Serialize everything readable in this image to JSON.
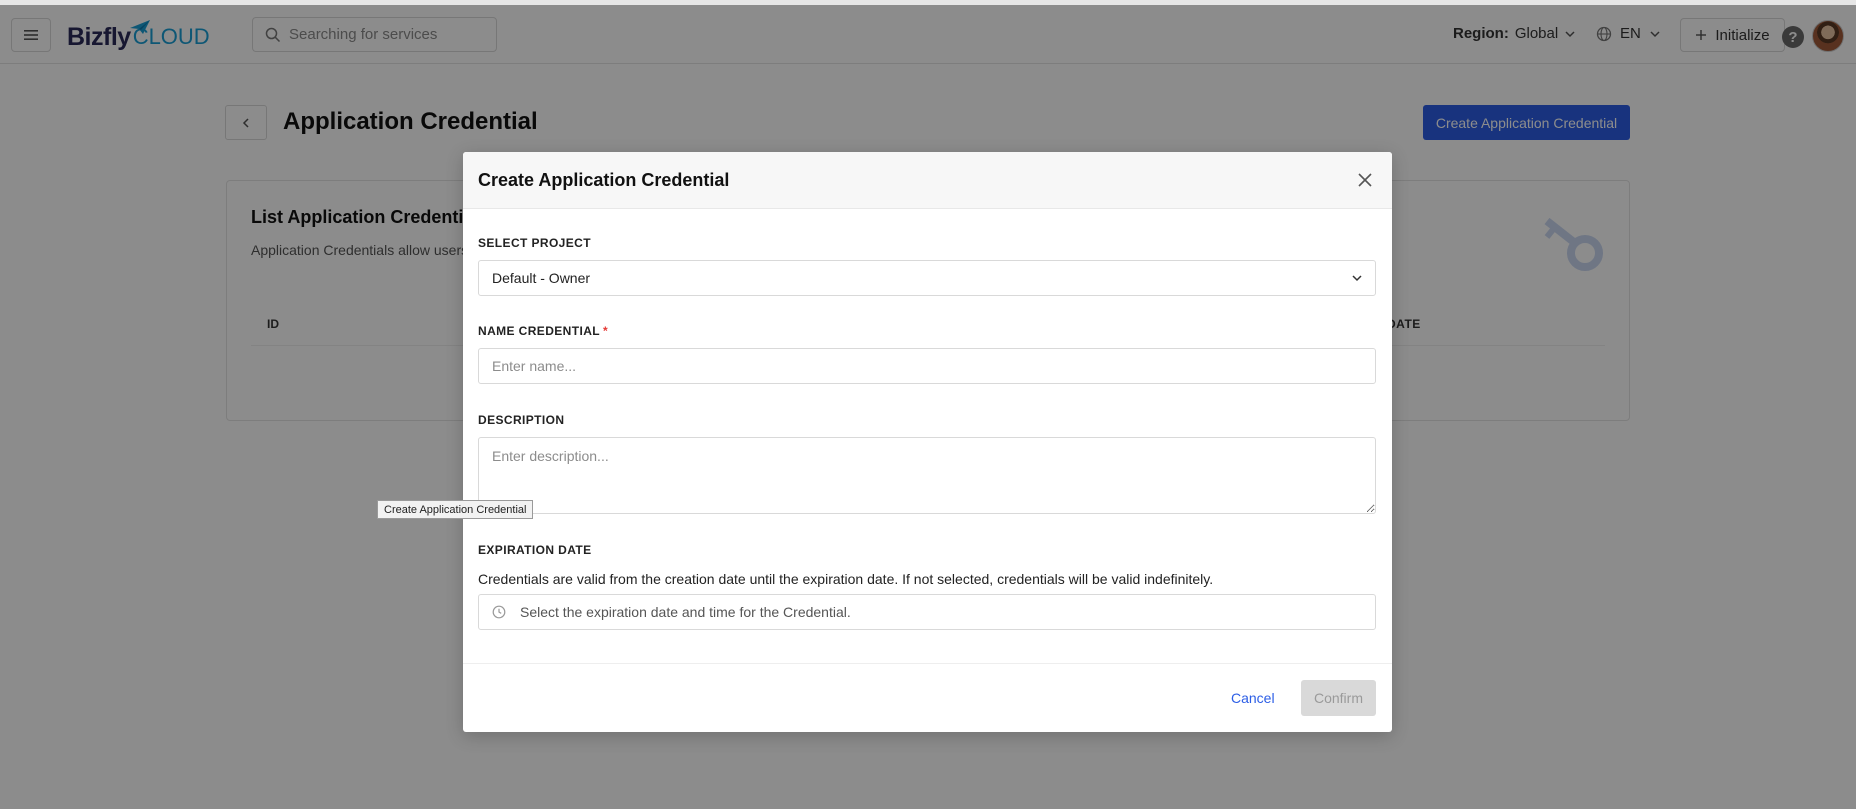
{
  "header": {
    "logo_main": "Bizfly",
    "logo_sub": "CLOUD",
    "search_placeholder": "Searching for services",
    "region_label": "Region:",
    "region_value": "Global",
    "language": "EN",
    "initialize_label": "Initialize",
    "help_label": "?"
  },
  "page": {
    "title": "Application Credential",
    "create_button": "Create Application Credential",
    "card": {
      "title": "List Application Credential",
      "description": "Application Credentials allow users",
      "col_id": "ID",
      "col_date": "DATE"
    },
    "tooltip": "Create Application Credential"
  },
  "modal": {
    "title": "Create Application Credential",
    "select_project_label": "SELECT PROJECT",
    "select_project_value": "Default - Owner",
    "name_label": "NAME CREDENTIAL",
    "name_required": "*",
    "name_placeholder": "Enter name...",
    "description_label": "DESCRIPTION",
    "description_placeholder": "Enter description...",
    "expiration_label": "EXPIRATION DATE",
    "expiration_note": "Credentials are valid from the creation date until the expiration date. If not selected, credentials will be valid indefinitely.",
    "expiration_placeholder": "Select the expiration date and time for the Credential.",
    "cancel_label": "Cancel",
    "confirm_label": "Confirm"
  },
  "colors": {
    "primary": "#2c5ee6",
    "required": "#e53935",
    "disabled_bg": "#d9d9d9",
    "overlay": "rgba(0,0,0,0.45)"
  }
}
